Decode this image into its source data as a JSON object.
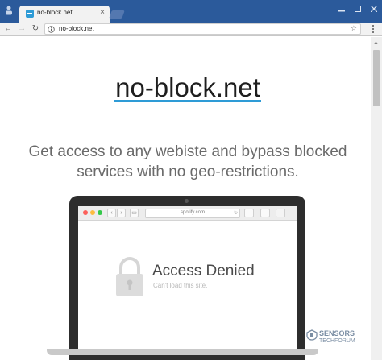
{
  "browser": {
    "tab_title": "no-block.net",
    "url": "no-block.net"
  },
  "page": {
    "site_title": "no-block.net",
    "tagline_line1": "Get access to any webiste and bypass blocked",
    "tagline_line2": "services with no geo-restrictions."
  },
  "mockup": {
    "url": "spotify.com",
    "heading": "Access Denied",
    "subtext": "Can't load this site."
  },
  "watermark": {
    "line1": "SENSORS",
    "line2": "TECHFORUM"
  },
  "colors": {
    "titlebar": "#2b5a9b",
    "accent_underline": "#2e9bd6",
    "dot_red": "#fc605b",
    "dot_yellow": "#fdbc40",
    "dot_green": "#34c84a"
  }
}
